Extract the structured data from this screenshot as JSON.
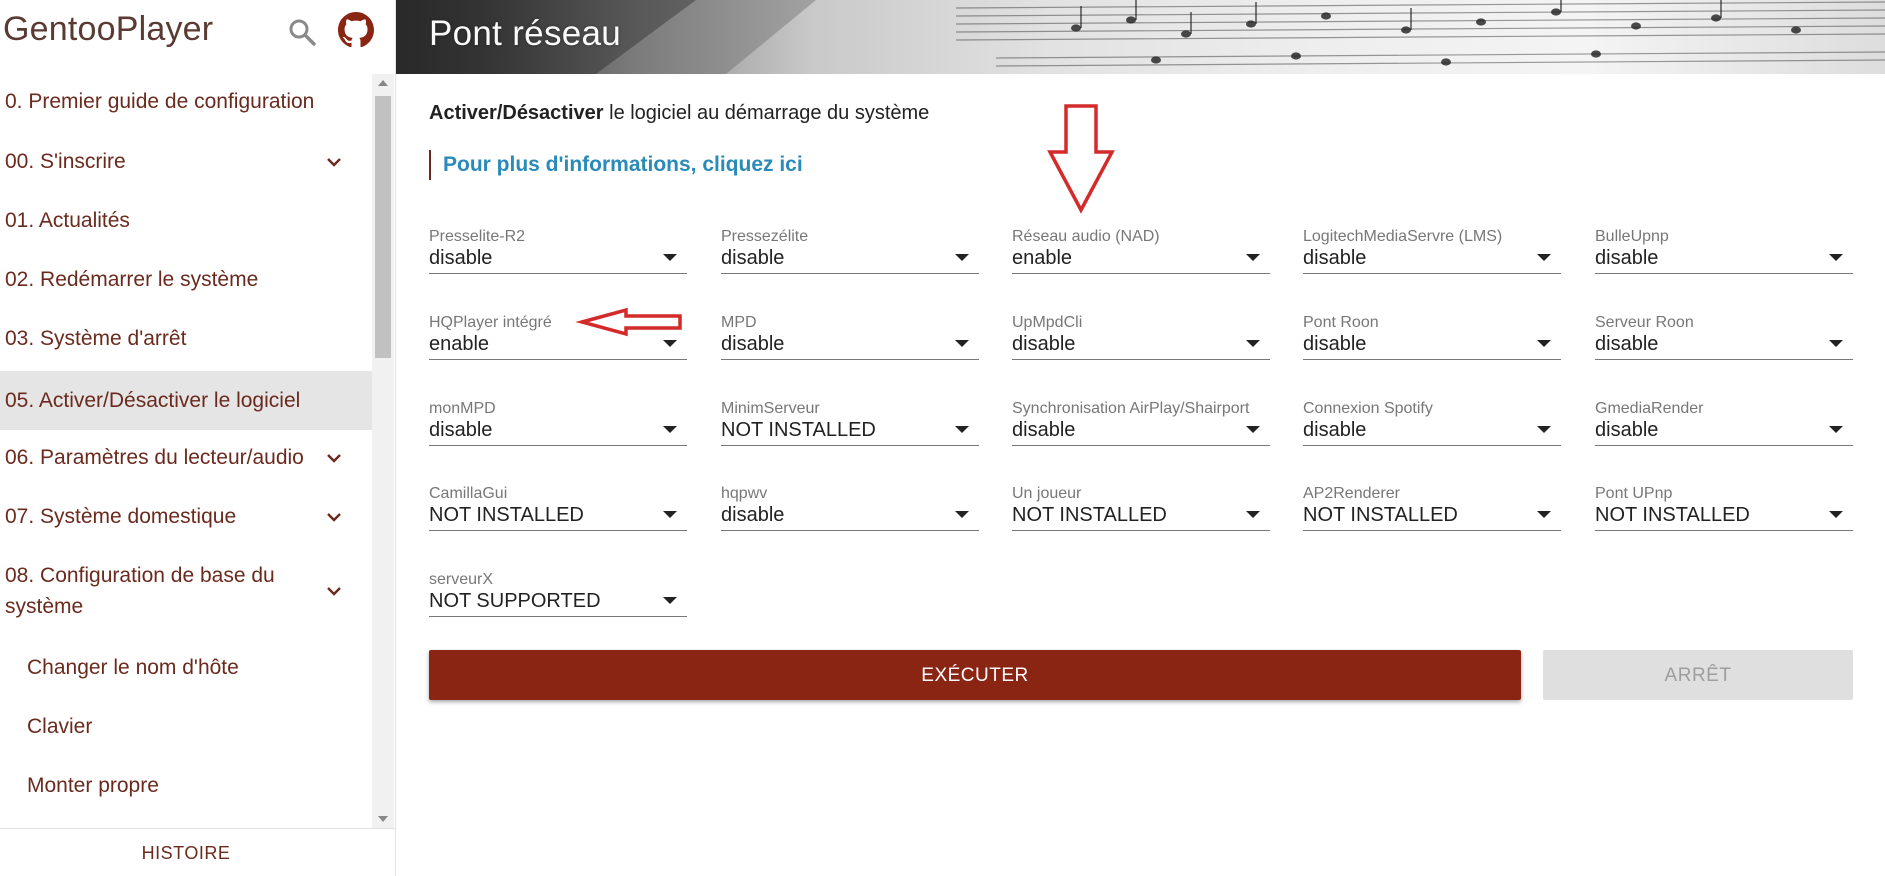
{
  "app": {
    "title": "GentooPlayer"
  },
  "sidebar": {
    "items": [
      {
        "label": "0. Premier guide de configuration",
        "expandable": false,
        "active": false
      },
      {
        "label": "00. S'inscrire",
        "expandable": true,
        "active": false
      },
      {
        "label": "01. Actualités",
        "expandable": false,
        "active": false
      },
      {
        "label": "02. Redémarrer le système",
        "expandable": false,
        "active": false
      },
      {
        "label": "03. Système d'arrêt",
        "expandable": false,
        "active": false
      },
      {
        "label": "05. Activer/Désactiver le logiciel",
        "expandable": false,
        "active": true
      },
      {
        "label": "06. Paramètres du lecteur/audio",
        "expandable": true,
        "active": false
      },
      {
        "label": "07. Système domestique",
        "expandable": true,
        "active": false
      },
      {
        "label": "08. Configuration de base du système",
        "expandable": true,
        "active": false
      },
      {
        "label": "Changer le nom d'hôte",
        "expandable": false,
        "active": false
      },
      {
        "label": "Clavier",
        "expandable": false,
        "active": false
      },
      {
        "label": "Monter propre",
        "expandable": false,
        "active": false
      }
    ],
    "footer_label": "HISTOIRE"
  },
  "header": {
    "title": "Pont réseau"
  },
  "main": {
    "intro_bold": "Activer/Désactiver",
    "intro_rest": " le logiciel au démarrage du système",
    "info_link": "Pour plus d'informations, cliquez ici",
    "fields": [
      {
        "label": "Presselite-R2",
        "value": "disable"
      },
      {
        "label": "Pressezélite",
        "value": "disable"
      },
      {
        "label": "Réseau audio (NAD)",
        "value": "enable"
      },
      {
        "label": "LogitechMediaServre (LMS)",
        "value": "disable"
      },
      {
        "label": "BulleUpnp",
        "value": "disable"
      },
      {
        "label": "HQPlayer intégré",
        "value": "enable"
      },
      {
        "label": "MPD",
        "value": "disable"
      },
      {
        "label": "UpMpdCli",
        "value": "disable"
      },
      {
        "label": "Pont Roon",
        "value": "disable"
      },
      {
        "label": "Serveur Roon",
        "value": "disable"
      },
      {
        "label": "monMPD",
        "value": "disable"
      },
      {
        "label": "MinimServeur",
        "value": "NOT INSTALLED"
      },
      {
        "label": "Synchronisation AirPlay/Shairport",
        "value": "disable"
      },
      {
        "label": "Connexion Spotify",
        "value": "disable"
      },
      {
        "label": "GmediaRender",
        "value": "disable"
      },
      {
        "label": "CamillaGui",
        "value": "NOT INSTALLED"
      },
      {
        "label": "hqpwv",
        "value": "disable"
      },
      {
        "label": "Un joueur",
        "value": "NOT INSTALLED"
      },
      {
        "label": "AP2Renderer",
        "value": "NOT INSTALLED"
      },
      {
        "label": "Pont UPnp",
        "value": "NOT INSTALLED"
      },
      {
        "label": "serveurX",
        "value": "NOT SUPPORTED"
      }
    ],
    "execute_label": "EXÉCUTER",
    "stop_label": "ARRÊT"
  },
  "colors": {
    "accent": "#8a2513",
    "nav_text": "#6b2a1e",
    "link": "#2a8ab8",
    "annotation": "#d42a2a",
    "active_item_bg": "#e5e5e5"
  }
}
